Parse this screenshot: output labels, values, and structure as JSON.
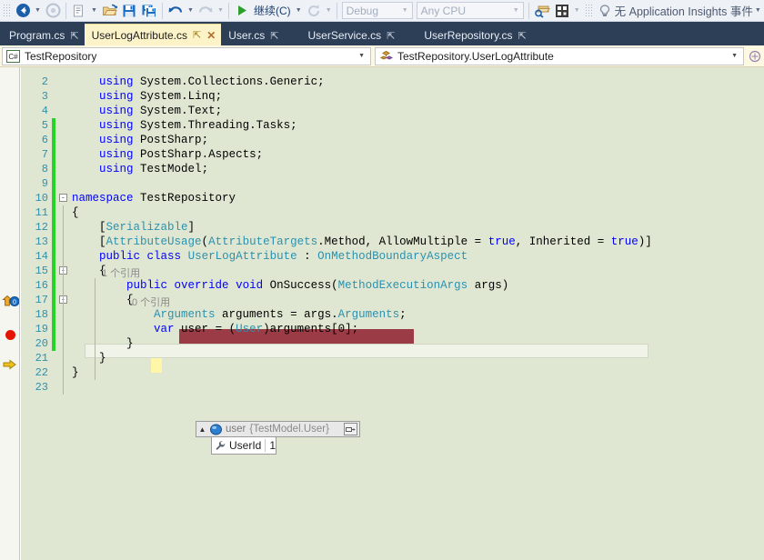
{
  "toolbar": {
    "nav_back": "navigate-back",
    "nav_forward": "navigate-forward",
    "new_item": "new-item",
    "open_file": "open-file",
    "save": "save",
    "save_all": "save-all",
    "undo": "undo",
    "redo": "redo",
    "continue_label": "继续(C)",
    "restart": "restart",
    "config_value": "Debug",
    "platform_value": "Any CPU",
    "find_in_files": "find-in-files",
    "preview_selected": "preview-selected-items",
    "app_insights_label": "无 Application Insights 事件"
  },
  "tabs": [
    {
      "label": "Program.cs",
      "pin": "⇱",
      "active": false,
      "closable": false
    },
    {
      "label": "UserLogAttribute.cs",
      "pin": "⇱",
      "active": true,
      "closable": true
    },
    {
      "label": "User.cs",
      "pin": "⇱",
      "active": false,
      "closable": false
    },
    {
      "label": "UserService.cs",
      "pin": "⇱",
      "active": false,
      "closable": false
    },
    {
      "label": "UserRepository.cs",
      "pin": "⇱",
      "active": false,
      "closable": false
    }
  ],
  "navbar": {
    "project_icon": "csharp-project-icon",
    "project_value": "TestRepository",
    "member_icon": "class-icon",
    "member_value": "TestRepository.UserLogAttribute",
    "tail_icon": "expand-icon"
  },
  "editor": {
    "lines": [
      {
        "n": "2",
        "code": "    using System.Collections.Generic;"
      },
      {
        "n": "3",
        "code": "    using System.Linq;"
      },
      {
        "n": "4",
        "code": "    using System.Text;"
      },
      {
        "n": "5",
        "code": "    using System.Threading.Tasks;"
      },
      {
        "n": "6",
        "code": "    using PostSharp;"
      },
      {
        "n": "7",
        "code": "    using PostSharp.Aspects;"
      },
      {
        "n": "8",
        "code": "    using TestModel;"
      },
      {
        "n": "9",
        "code": ""
      },
      {
        "n": "10",
        "code": "namespace TestRepository"
      },
      {
        "n": "11",
        "code": "{"
      },
      {
        "n": "12",
        "code": "    [Serializable]"
      },
      {
        "n": "13",
        "code": "    [AttributeUsage(AttributeTargets.Method, AllowMultiple = true, Inherited = true)]"
      },
      {
        "n": "14",
        "code": "    public class UserLogAttribute : OnMethodBoundaryAspect"
      },
      {
        "n": "15",
        "code": "    {"
      },
      {
        "n": "16",
        "code": "        public override void OnSuccess(MethodExecutionArgs args)"
      },
      {
        "n": "17",
        "code": "        {"
      },
      {
        "n": "18",
        "code": "            Arguments arguments = args.Arguments;"
      },
      {
        "n": "19",
        "code": "            var user = (User)arguments[0];"
      },
      {
        "n": "20",
        "code": "        }"
      },
      {
        "n": "21",
        "code": "    }"
      },
      {
        "n": "22",
        "code": "}"
      },
      {
        "n": "23",
        "code": ""
      }
    ],
    "codelens_class": "1 个引用",
    "codelens_method": "0 个引用",
    "glyphs": {
      "override_glyph": "override-indicator-icon",
      "breakpoint": "breakpoint-icon",
      "current_statement": "current-statement-arrow-icon"
    }
  },
  "datatip": {
    "expander": "▲",
    "type_icon": "object-bubble-icon",
    "name": "user",
    "value": "{TestModel.User}",
    "pin_icon": "pin-to-source-icon",
    "child_icon": "property-wrench-icon",
    "child_name": "UserId",
    "child_value": "1"
  },
  "colors": {
    "tab_active_bg": "#fdf3c8",
    "tabstrip_bg": "#2d3e57",
    "editor_bg": "#dfe7d2",
    "breakpoint_line_bg": "#9b3b46",
    "breakpoint_red": "#e51400",
    "current_stmt_yellow": "#fff6a8",
    "changebar_green": "#27d427",
    "keyword_blue": "#0000ff",
    "type_teal": "#2b91af",
    "linenum_teal": "#2b91af"
  }
}
